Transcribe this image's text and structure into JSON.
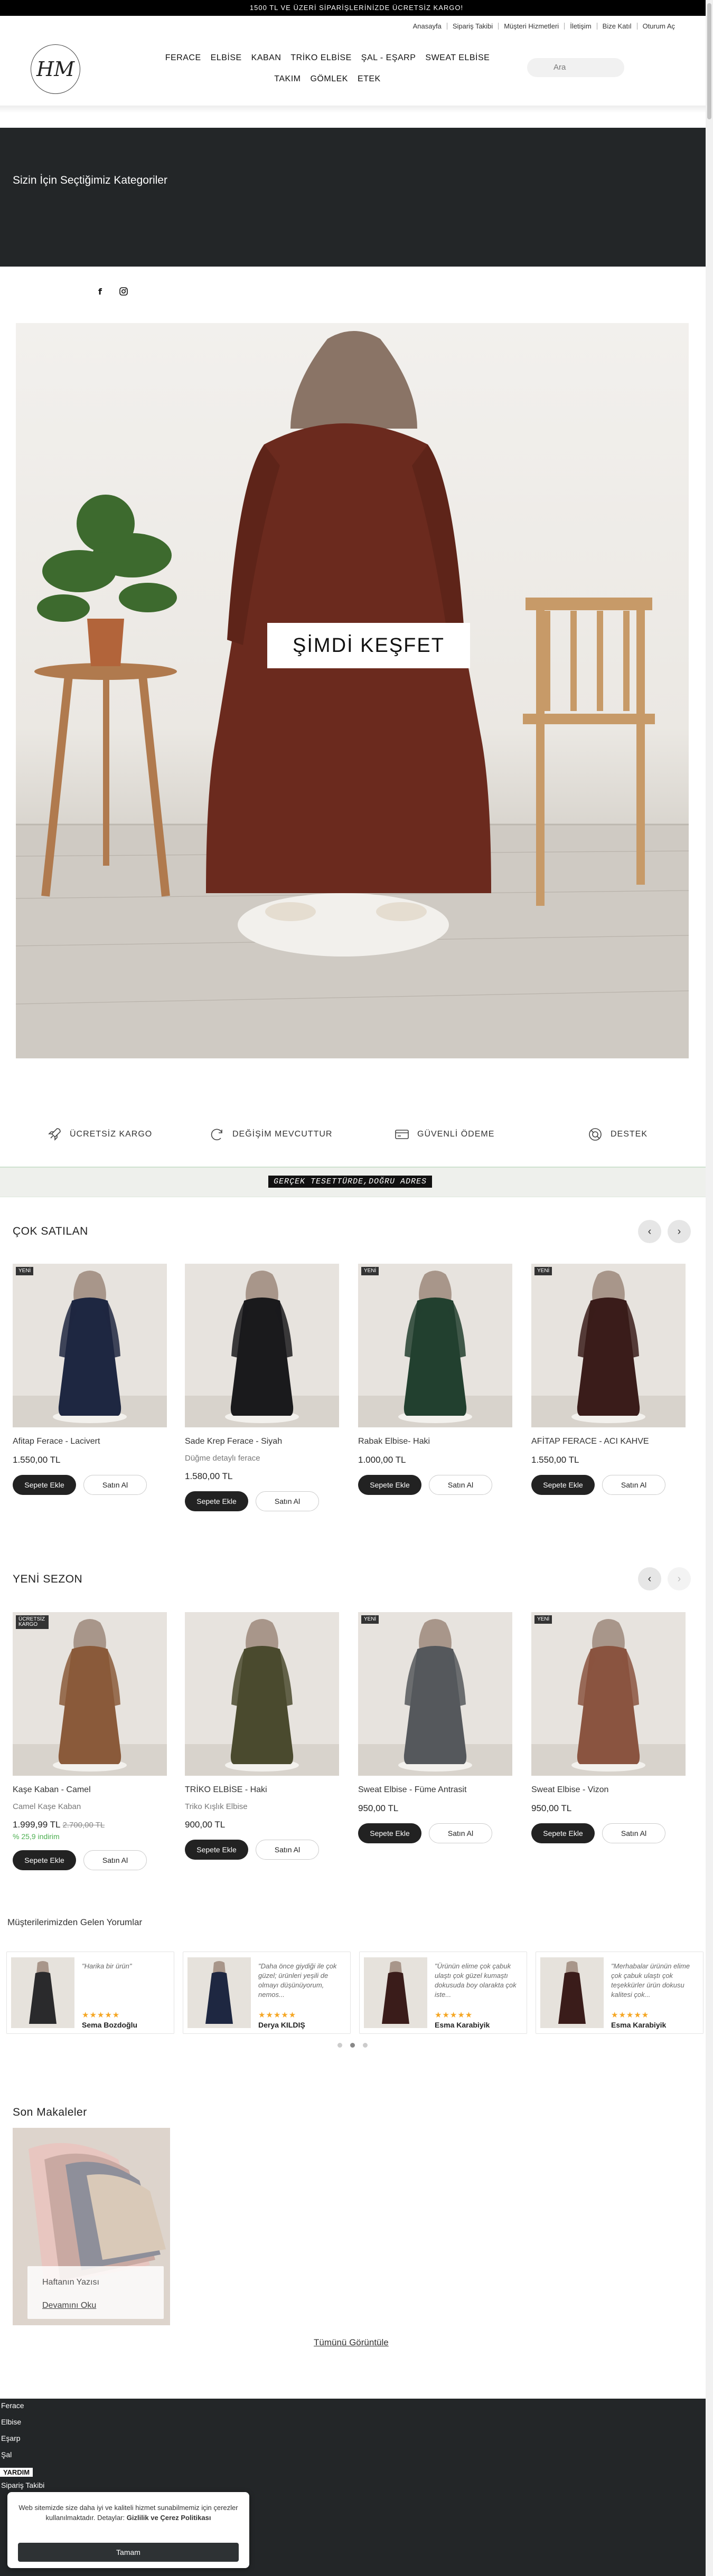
{
  "announcement": "1500 TL VE ÜZERİ SİPARİŞLERİNİZDE ÜCRETSİZ KARGO!",
  "top_links": [
    "Anasayfa",
    "Sipariş Takibi",
    "Müşteri Hizmetleri",
    "İletişim",
    "Bize Katıl",
    "Oturum Aç"
  ],
  "logo_text": "HM",
  "nav": {
    "row1": [
      "FERACE",
      "ELBİSE",
      "KABAN",
      "TRİKO ELBİSE",
      "ŞAL - EŞARP",
      "SWEAT ELBİSE",
      "TAKIM"
    ],
    "row2": [
      "GÖMLEK",
      "ETEK"
    ]
  },
  "search_placeholder": "Ara",
  "categories_title": "Sizin İçin Seçtiğimiz Kategoriler",
  "social": {
    "facebook": "f",
    "instagram": "instagram-icon"
  },
  "hero": {
    "button": "ŞİMDİ KEŞFET"
  },
  "features": [
    "ÜCRETSİZ KARGO",
    "DEĞİŞİM MEVCUTTUR",
    "GÜVENLİ ÖDEME",
    "DESTEK"
  ],
  "slogan": "GERÇEK TESETTÜRDE,DOĞRU ADRES",
  "bestsellers": {
    "title": "ÇOK SATILAN",
    "items": [
      {
        "badge": "YENİ",
        "name": "Afitap Ferace - Lacivert",
        "sub": "",
        "price": "1.550,00 TL",
        "color": "#1e2741"
      },
      {
        "badge": "",
        "name": "Sade Krep Ferace - Siyah",
        "sub": "Düğme detaylı ferace",
        "price": "1.580,00 TL",
        "color": "#1a1a1c"
      },
      {
        "badge": "YENİ",
        "name": "Rabak Elbise- Haki",
        "sub": "",
        "price": "1.000,00 TL",
        "color": "#22402f"
      },
      {
        "badge": "YENİ",
        "name": "AFİTAP FERACE - ACI KAHVE",
        "sub": "",
        "price": "1.550,00 TL",
        "color": "#3a1c1a"
      }
    ],
    "cart_label": "Sepete Ekle",
    "buy_label": "Satın Al"
  },
  "newseason": {
    "title": "YENİ SEZON",
    "items": [
      {
        "badge": "ÜCRETSİZ KARGO",
        "name": "Kaşe Kaban - Camel",
        "sub": "Camel Kaşe Kaban",
        "price": "1.999,99 TL",
        "old": "2.700,00 TL",
        "disc": "% 25,9 indirim",
        "color": "#8a5a3a"
      },
      {
        "badge": "",
        "name": "TRİKO ELBİSE - Haki",
        "sub": "Triko Kışlık Elbise",
        "price": "900,00 TL",
        "old": "",
        "disc": "",
        "color": "#4a4a2e"
      },
      {
        "badge": "YENİ",
        "name": "Sweat Elbise - Füme Antrasit",
        "sub": "",
        "price": "950,00 TL",
        "old": "",
        "disc": "",
        "color": "#55585c"
      },
      {
        "badge": "YENİ",
        "name": "Sweat Elbise - Vizon",
        "sub": "",
        "price": "950,00 TL",
        "old": "",
        "disc": "",
        "color": "#8a5440"
      }
    ]
  },
  "reviews": {
    "title": "Müşterilerimizden Gelen Yorumlar",
    "items": [
      {
        "quote": "\"Harika bir ürün\"",
        "name": "Sema Bozdoğlu",
        "color": "#2a2a2c"
      },
      {
        "quote": "\"Daha önce giydiği ile çok güzel; ürünleri yeşili de olmayı düşünüyorum, nemos...",
        "name": "Derya KILDIŞ",
        "color": "#1e2741"
      },
      {
        "quote": "\"Ürünün elime çok çabuk ulaştı çok güzel kumaştı dokusuda boy olarakta çok iste...",
        "name": "Esma Karabiyik",
        "color": "#3a1c1a"
      },
      {
        "quote": "\"Merhabalar ürünün elime çok çabuk ulaştı çok teşekkürler ürün dokusu kalitesi çok...",
        "name": "Esma Karabiyik",
        "color": "#3a1c1a"
      }
    ],
    "stars": "★★★★★"
  },
  "articles": {
    "title": "Son Makaleler",
    "item_title": "Haftanın Yazısı",
    "item_link": "Devamını Oku",
    "view_all": "Tümünü Görüntüle"
  },
  "footer_links": [
    "Ferace",
    "Elbise",
    "Eşarp",
    "Şal",
    "Sipariş Takibi"
  ],
  "help_label": "YARDIM",
  "cookie": {
    "text_a": "Web sitemizde size daha iyi ve kaliteli hizmet sunabilmemiz için çerezler kullanılmaktadır. Detaylar:",
    "text_b": "Gizlilik ve Çerez Politikası",
    "button": "Tamam"
  }
}
